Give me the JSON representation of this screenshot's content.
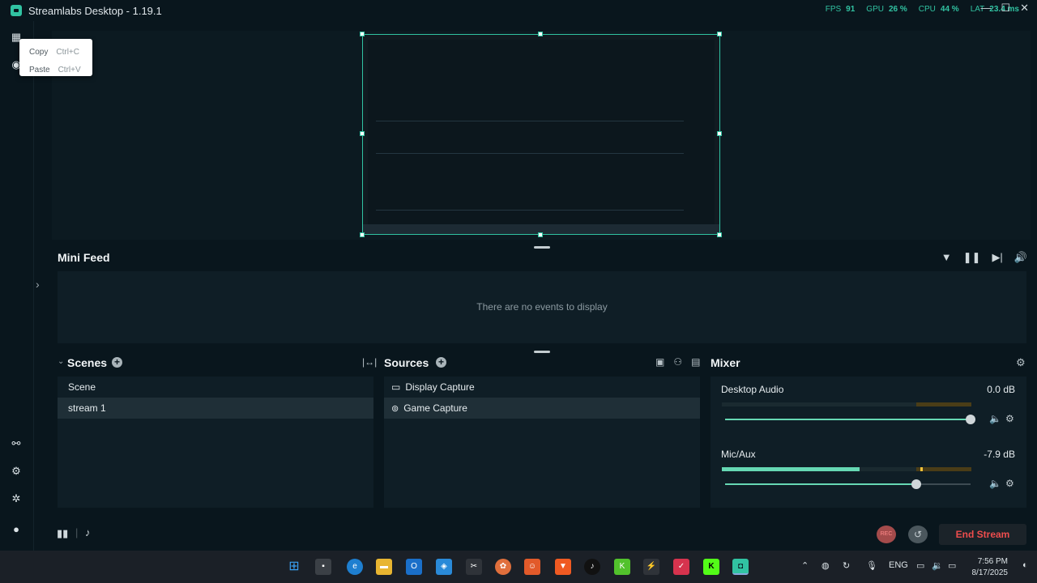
{
  "window": {
    "title": "Streamlabs Desktop - 1.19.1",
    "fps_label": "FPS",
    "fps_value": "91",
    "gpu_label": "GPU",
    "gpu_value": "26 %",
    "cpu_label": "CPU",
    "cpu_value": "44 %",
    "lat_label": "LAT",
    "lat_value": "23.4 ms"
  },
  "context_menu": {
    "items": [
      {
        "label": "Copy",
        "shortcut": "Ctrl+C"
      },
      {
        "label": "Paste",
        "shortcut": "Ctrl+V"
      }
    ]
  },
  "minifeed": {
    "title": "Mini Feed",
    "empty_text": "There are no events to display"
  },
  "scenes": {
    "title": "Scenes",
    "items": [
      {
        "label": "Scene",
        "selected": false
      },
      {
        "label": "stream 1",
        "selected": true
      }
    ]
  },
  "sources": {
    "title": "Sources",
    "items": [
      {
        "label": "Display Capture",
        "icon": "monitor-icon",
        "selected": false
      },
      {
        "label": "Game Capture",
        "icon": "gamepad-icon",
        "selected": true
      }
    ]
  },
  "mixer": {
    "title": "Mixer",
    "channels": [
      {
        "label": "Desktop Audio",
        "db": "0.0 dB",
        "meter_level": 0.0,
        "volume": 1.0
      },
      {
        "label": "Mic/Aux",
        "db": "-7.9 dB",
        "meter_level": 0.55,
        "volume": 0.78
      }
    ]
  },
  "footer": {
    "rec_label": "REC",
    "end_stream_label": "End Stream"
  },
  "taskbar": {
    "lang": "ENG",
    "time": "7:56 PM",
    "date": "8/17/2025"
  },
  "colors": {
    "accent": "#31c3a2",
    "background": "#09161d",
    "panel": "#0f1e26",
    "danger": "#ee4d4d"
  }
}
